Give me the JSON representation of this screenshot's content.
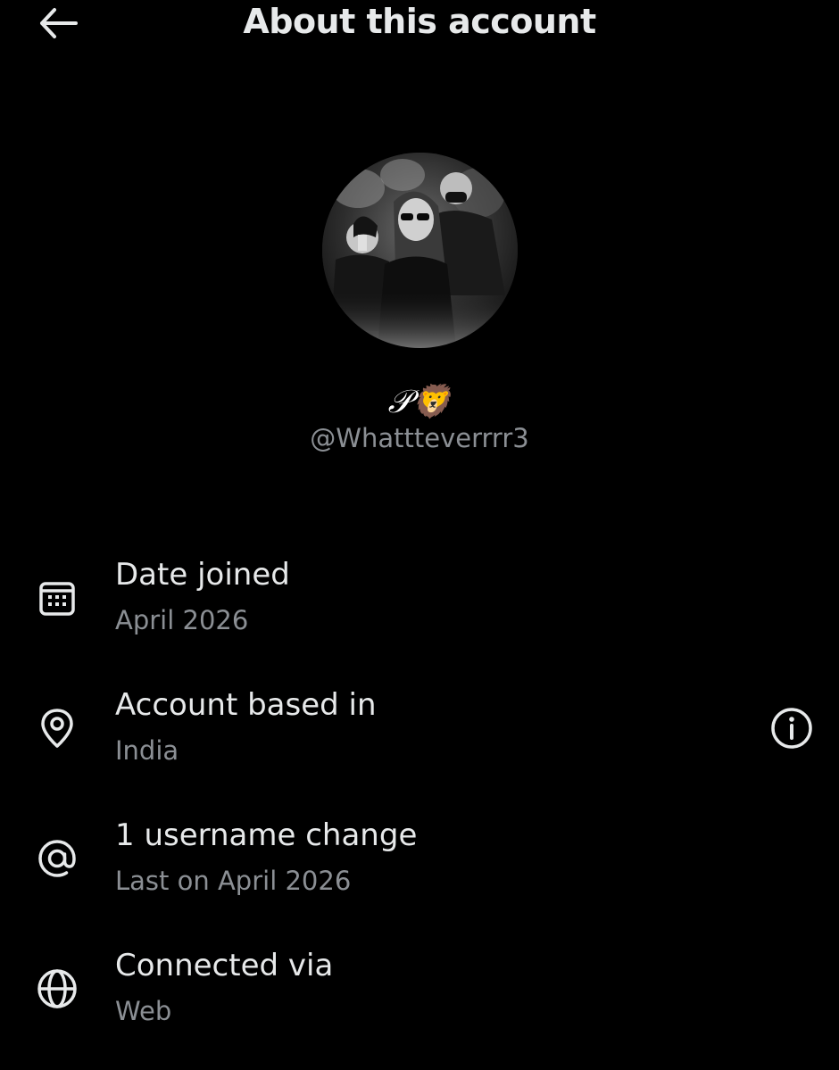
{
  "header": {
    "title": "About this account",
    "back_icon": "arrow-left-icon"
  },
  "profile": {
    "avatar_icon": "profile-photo",
    "display_name": "𝒫🦁",
    "handle": "@Whattteverrrr3"
  },
  "details": [
    {
      "icon": "calendar-icon",
      "title": "Date joined",
      "value": "April 2026"
    },
    {
      "icon": "location-pin-icon",
      "title": "Account based in",
      "value": "India",
      "action_icon": "info-icon"
    },
    {
      "icon": "at-sign-icon",
      "title": "1 username change",
      "value": "Last on April 2026"
    },
    {
      "icon": "globe-icon",
      "title": "Connected via",
      "value": "Web"
    }
  ],
  "colors": {
    "background": "#000000",
    "primary_text": "#e7e9ea",
    "secondary_text": "#8b8f94"
  }
}
